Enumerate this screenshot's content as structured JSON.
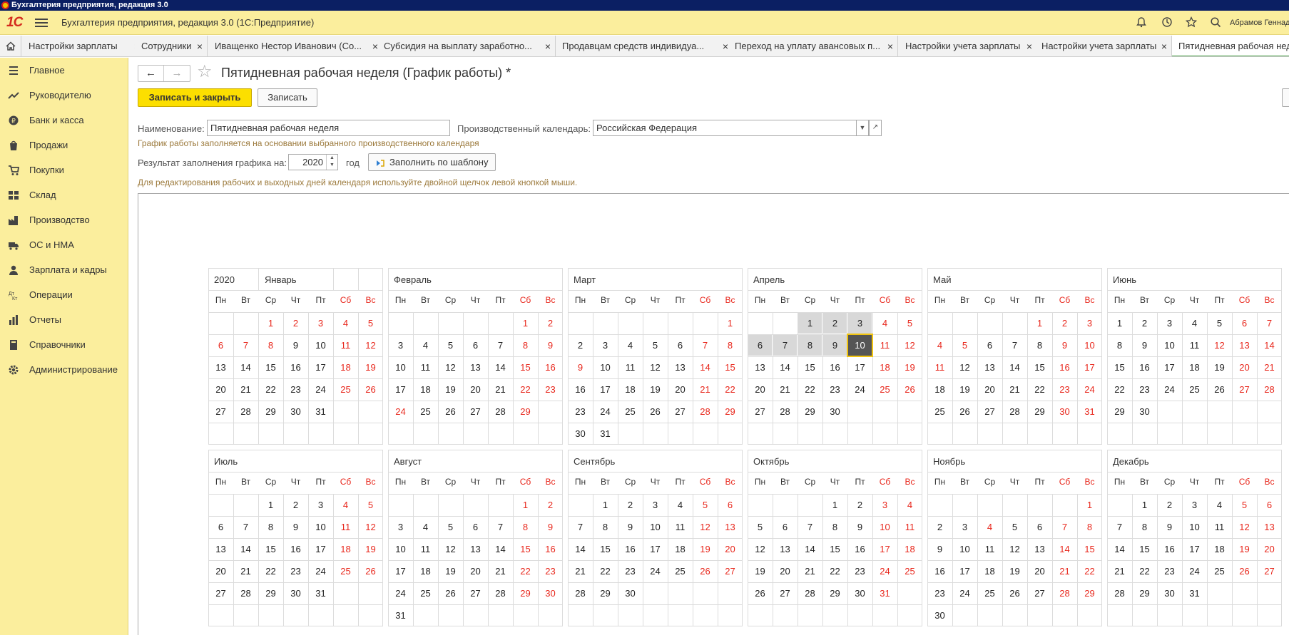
{
  "os": {
    "title": "Бухгалтерия предприятия, редакция 3.0"
  },
  "topbar": {
    "logo": "1С",
    "app_name": "Бухгалтерия предприятия, редакция 3.0  (1С:Предприятие)",
    "user": "Абрамов Геннадий"
  },
  "tabs": [
    {
      "label": "Настройки зарплаты"
    },
    {
      "label": "Сотрудники"
    },
    {
      "label": "Иващенко Нестор Иванович (Со..."
    },
    {
      "label": "Субсидия на выплату заработно..."
    },
    {
      "label": "Продавцам средств индивидуа..."
    },
    {
      "label": "Переход на уплату авансовых п..."
    },
    {
      "label": "Настройки учета зарплаты"
    },
    {
      "label": "Настройки учета зарплаты"
    },
    {
      "label": "Пятидневная рабочая неделя"
    }
  ],
  "sidebar": {
    "items": [
      {
        "label": "Главное",
        "icon": "menu-icon"
      },
      {
        "label": "Руководителю",
        "icon": "trend-icon"
      },
      {
        "label": "Банк и касса",
        "icon": "bank-icon"
      },
      {
        "label": "Продажи",
        "icon": "bag-icon"
      },
      {
        "label": "Покупки",
        "icon": "cart-icon"
      },
      {
        "label": "Склад",
        "icon": "warehouse-icon"
      },
      {
        "label": "Производство",
        "icon": "factory-icon"
      },
      {
        "label": "ОС и НМА",
        "icon": "truck-icon"
      },
      {
        "label": "Зарплата и кадры",
        "icon": "person-icon"
      },
      {
        "label": "Операции",
        "icon": "operations-icon"
      },
      {
        "label": "Отчеты",
        "icon": "chart-icon"
      },
      {
        "label": "Справочники",
        "icon": "book-icon"
      },
      {
        "label": "Администрирование",
        "icon": "gear-icon"
      }
    ]
  },
  "form": {
    "title": "Пятидневная рабочая неделя (График работы) *",
    "save_close_label": "Записать и закрыть",
    "save_label": "Записать",
    "name_label": "Наименование:",
    "name_value": "Пятидневная рабочая неделя",
    "calendar_label": "Производственный календарь:",
    "calendar_value": "Российская Федерация",
    "hint_calendar": "График работы заполняется на основании выбранного производственного календаря",
    "result_label": "Результат заполнения графика на:",
    "year_value": "2020",
    "year_suffix": "год",
    "fill_label": "Заполнить по шаблону",
    "hint_edit": "Для редактирования рабочих и выходных дней календаря используйте двойной щелчок левой кнопкой мыши."
  },
  "calendar": {
    "year": "2020",
    "weekdays": [
      "Пн",
      "Вт",
      "Ср",
      "Чт",
      "Пт",
      "Сб",
      "Вс"
    ],
    "months": [
      {
        "name": "Январь",
        "days": 31,
        "start": 2,
        "holidays": [
          1,
          2,
          3,
          6,
          7,
          8
        ]
      },
      {
        "name": "Февраль",
        "days": 29,
        "start": 5,
        "holidays": [
          24
        ]
      },
      {
        "name": "Март",
        "days": 31,
        "start": 6,
        "holidays": [
          9
        ]
      },
      {
        "name": "Апрель",
        "days": 30,
        "start": 2,
        "holidays": [],
        "selected": [
          1,
          2,
          3,
          6,
          7,
          8,
          9
        ],
        "current": 10
      },
      {
        "name": "Май",
        "days": 31,
        "start": 4,
        "holidays": [
          1,
          4,
          5,
          11
        ]
      },
      {
        "name": "Июнь",
        "days": 30,
        "start": 0,
        "holidays": [
          12
        ]
      },
      {
        "name": "Июль",
        "days": 31,
        "start": 2,
        "holidays": []
      },
      {
        "name": "Август",
        "days": 31,
        "start": 5,
        "holidays": []
      },
      {
        "name": "Сентябрь",
        "days": 30,
        "start": 1,
        "holidays": []
      },
      {
        "name": "Октябрь",
        "days": 31,
        "start": 3,
        "holidays": []
      },
      {
        "name": "Ноябрь",
        "days": 30,
        "start": 6,
        "holidays": [
          4
        ]
      },
      {
        "name": "Декабрь",
        "days": 31,
        "start": 1,
        "holidays": []
      }
    ]
  }
}
